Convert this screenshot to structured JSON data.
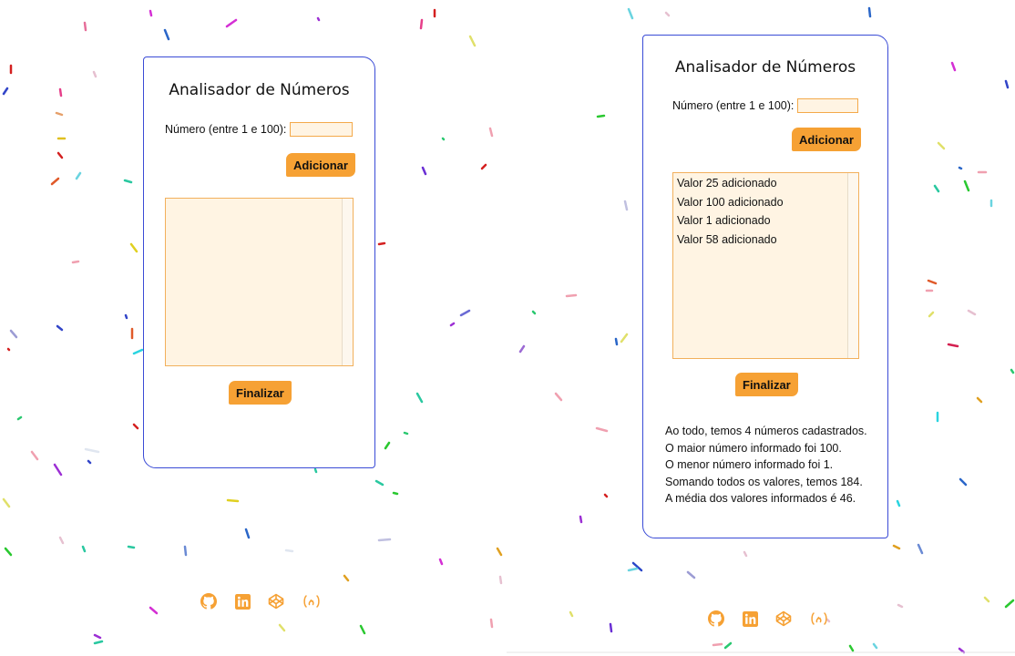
{
  "accent_color": "#f6a134",
  "border_color": "#3a4bd6",
  "social_icon_color": "#f6a134",
  "left_panel": {
    "title": "Analisador de Números",
    "number_label": "Número (entre 1 e 100):",
    "number_value": "",
    "add_button": "Adicionar",
    "list_items": [],
    "finish_button": "Finalizar",
    "results": []
  },
  "right_panel": {
    "title": "Analisador de Números",
    "number_label": "Número (entre 1 e 100):",
    "number_value": "",
    "add_button": "Adicionar",
    "list_items": [
      "Valor 25 adicionado",
      "Valor 100 adicionado",
      "Valor 1 adicionado",
      "Valor 58 adicionado"
    ],
    "finish_button": "Finalizar",
    "results": [
      "Ao todo, temos 4 números cadastrados.",
      "O maior número informado foi 100.",
      "O menor número informado foi 1.",
      "Somando todos os valores, temos 184.",
      "A média dos valores informados é 46."
    ]
  },
  "social_icons": [
    "github-icon",
    "linkedin-icon",
    "codepen-icon",
    "freecodecamp-icon"
  ]
}
